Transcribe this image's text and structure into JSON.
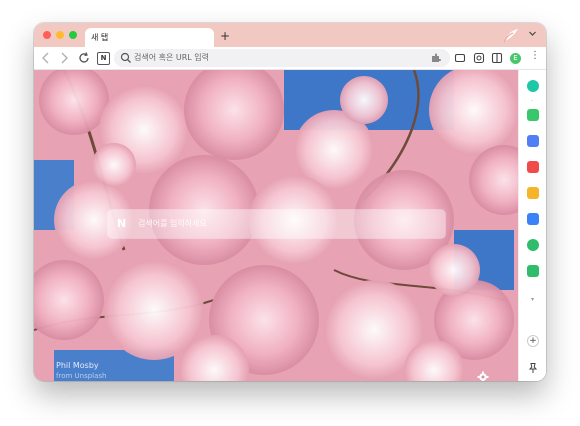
{
  "window": {
    "tab_title": "새 탭",
    "new_tab_label": "+"
  },
  "toolbar": {
    "omnibox_placeholder": "검색어 혹은 URL 입력",
    "naver_badge": "N",
    "profile_initial": "E",
    "menu_label": "⋮"
  },
  "content": {
    "search_placeholder": "검색어를 입력하세요",
    "naver_logo": "N",
    "photo_credit_name": "Phil Mosby",
    "photo_credit_site": "from Unsplash"
  },
  "sidebar": {
    "apps": [
      {
        "icon": "whale-icon",
        "color": "#1fc7a8"
      },
      {
        "icon": "talk-icon",
        "color": "#39c76b"
      },
      {
        "icon": "calendar-icon",
        "color": "#4f7ef5"
      },
      {
        "icon": "pocket-icon",
        "color": "#ef4b4b"
      },
      {
        "icon": "bookmark-star-icon",
        "color": "#f5b42a"
      },
      {
        "icon": "translate-icon",
        "color": "#3b82f6"
      },
      {
        "icon": "music-icon",
        "color": "#2fbd6b"
      },
      {
        "icon": "game-icon",
        "color": "#2fbd6b"
      }
    ],
    "more_label": "▾",
    "add_label": "+"
  },
  "colors": {
    "tabstrip": "#f2c9c2",
    "sky": "#3f77c8",
    "blossom": "#f3b9c7"
  }
}
